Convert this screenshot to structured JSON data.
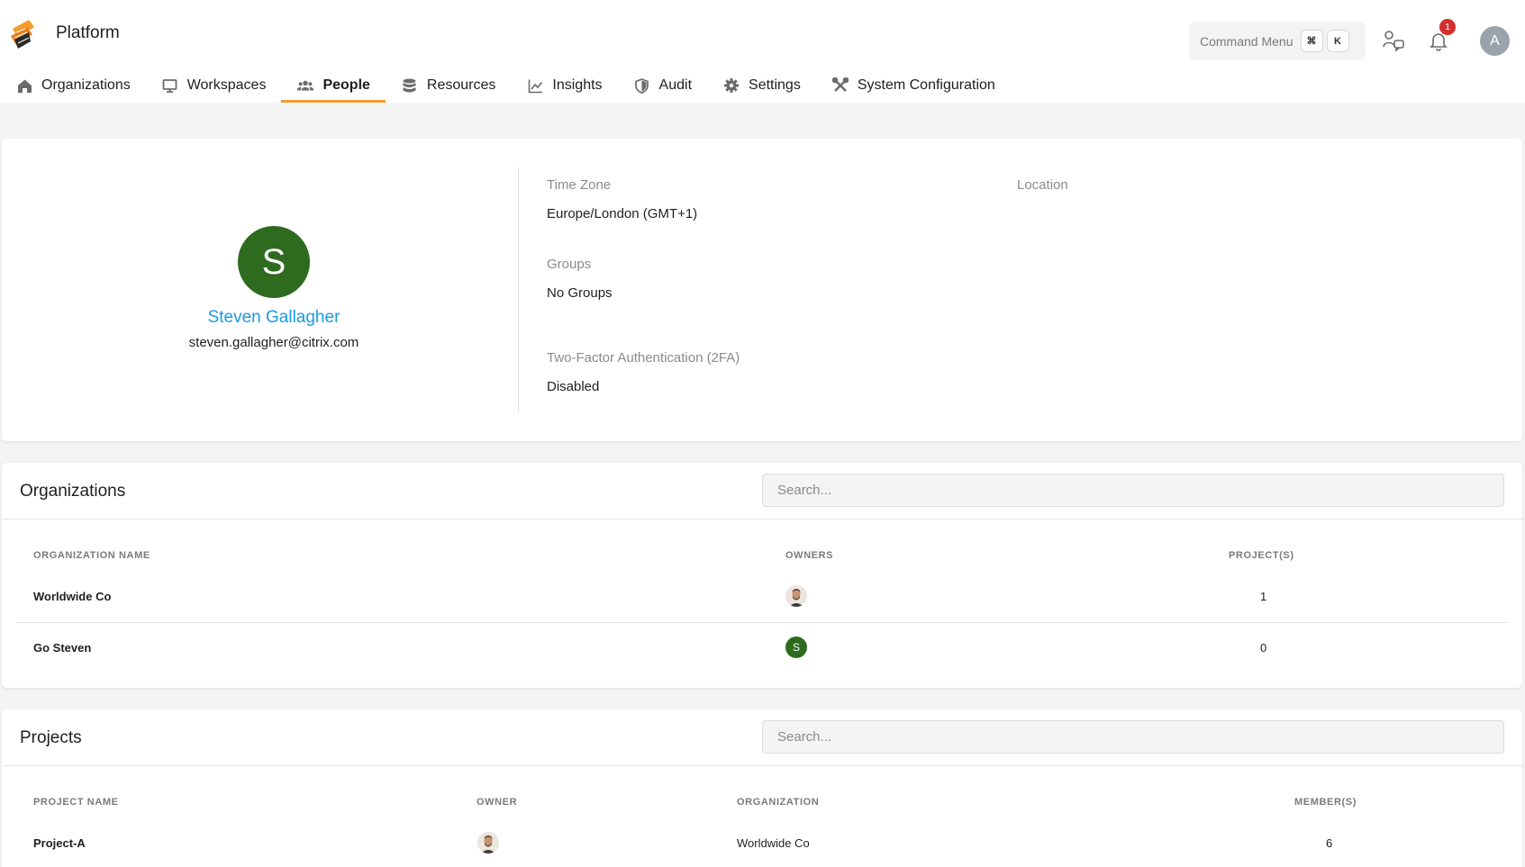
{
  "app": {
    "name": "Platform"
  },
  "command_menu": {
    "label": "Command Menu",
    "key1": "⌘",
    "key2": "K"
  },
  "notifications": {
    "count": "1"
  },
  "user": {
    "initial": "A"
  },
  "nav": [
    {
      "label": "Organizations",
      "icon": "home-icon"
    },
    {
      "label": "Workspaces",
      "icon": "monitor-icon"
    },
    {
      "label": "People",
      "icon": "people-icon",
      "active": true
    },
    {
      "label": "Resources",
      "icon": "database-icon"
    },
    {
      "label": "Insights",
      "icon": "chart-icon"
    },
    {
      "label": "Audit",
      "icon": "shield-icon"
    },
    {
      "label": "Settings",
      "icon": "gear-icon"
    },
    {
      "label": "System Configuration",
      "icon": "tools-icon"
    }
  ],
  "profile": {
    "initial": "S",
    "name": "Steven Gallagher",
    "email": "steven.gallagher@citrix.com",
    "time_zone_label": "Time Zone",
    "time_zone": "Europe/London (GMT+1)",
    "location_label": "Location",
    "groups_label": "Groups",
    "groups": "No Groups",
    "twofa_label": "Two-Factor Authentication (2FA)",
    "twofa": "Disabled",
    "avatar_color": "#2e6b1f"
  },
  "organizations": {
    "title": "Organizations",
    "search_placeholder": "Search...",
    "columns": [
      "ORGANIZATION NAME",
      "OWNERS",
      "PROJECT(S)"
    ],
    "rows": [
      {
        "name": "Worldwide Co",
        "owner": "photo",
        "projects": "1"
      },
      {
        "name": "Go Steven",
        "owner": "S",
        "projects": "0"
      }
    ]
  },
  "projects": {
    "title": "Projects",
    "search_placeholder": "Search...",
    "columns": [
      "PROJECT NAME",
      "OWNER",
      "ORGANIZATION",
      "MEMBER(S)"
    ],
    "rows": [
      {
        "name": "Project-A",
        "owner": "photo",
        "organization": "Worldwide Co",
        "members": "6"
      }
    ]
  },
  "colors": {
    "accent": "#f39c2c",
    "link": "#1a9ae0",
    "badge": "#d32f2f"
  }
}
